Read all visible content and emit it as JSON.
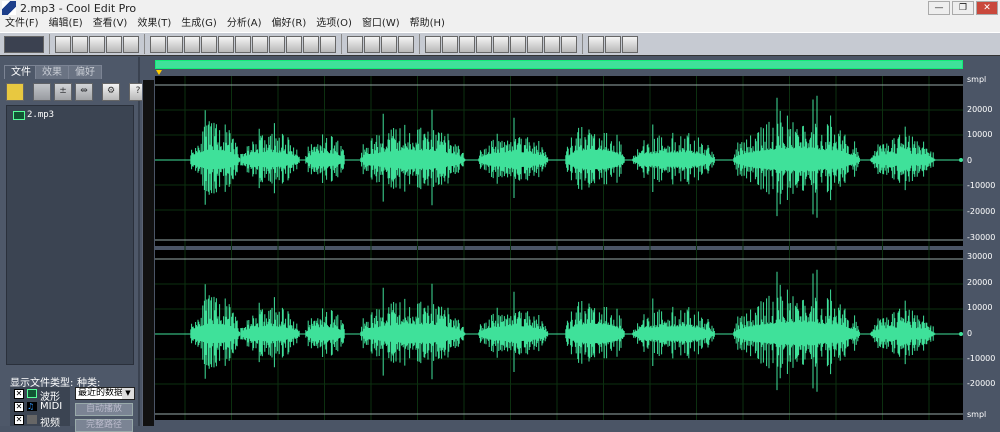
{
  "window": {
    "title": "2.mp3 - Cool Edit Pro",
    "controls": [
      "minimize",
      "restore",
      "close"
    ]
  },
  "menu": [
    "文件(F)",
    "编辑(E)",
    "查看(V)",
    "效果(T)",
    "生成(G)",
    "分析(A)",
    "偏好(R)",
    "选项(O)",
    "窗口(W)",
    "帮助(H)"
  ],
  "toolbar": {
    "groups": [
      [
        "multitrack-toggle-icon"
      ],
      [
        "new-icon",
        "open-icon",
        "save-icon",
        "save-as-icon",
        "save-all-icon"
      ],
      [
        "undo-icon",
        "redo-icon",
        "trim-icon",
        "copy-new-icon",
        "copy-icon",
        "cut-icon",
        "paste-icon",
        "paste-new-icon",
        "mix-paste-icon",
        "cd-icon",
        "loop-icon"
      ],
      [
        "envelope-icon",
        "normalize-icon",
        "amplify-icon",
        "eq-icon"
      ],
      [
        "window-1-icon",
        "window-2-icon",
        "window-3-icon",
        "transport-icon",
        "zoom-icon",
        "time-icon",
        "selection-icon",
        "level-meter-icon",
        "status-icon"
      ],
      [
        "settings-icon",
        "script-icon",
        "help-icon"
      ]
    ]
  },
  "left_panel": {
    "tabs": [
      "文件",
      "效果",
      "偏好"
    ],
    "active_tab": 0,
    "buttons": [
      "open-file-icon",
      "close-file-icon",
      "insert-icon",
      "insert-multi-icon",
      "settings-icon",
      "help-icon"
    ],
    "files": [
      {
        "name": "2.mp3",
        "icon": "waveform-icon"
      }
    ],
    "file_types_label": "显示文件类型:",
    "file_types": [
      {
        "label": "波形",
        "checked": true
      },
      {
        "label": "MIDI",
        "checked": true
      },
      {
        "label": "视频",
        "checked": true
      }
    ],
    "kind_label": "种类:",
    "kind_value": "最近的数据",
    "autoplay_label": "自动播放",
    "fullpath_label": "完整路径"
  },
  "editor": {
    "waveform_color": "#3fe19a",
    "channels": [
      {
        "unit": "smpl",
        "ticks": [
          "20000",
          "10000",
          "0",
          "-10000",
          "-20000",
          "-30000"
        ]
      },
      {
        "unit": "smpl",
        "ticks": [
          "30000",
          "20000",
          "10000",
          "0",
          "-10000",
          "-20000"
        ]
      }
    ]
  }
}
